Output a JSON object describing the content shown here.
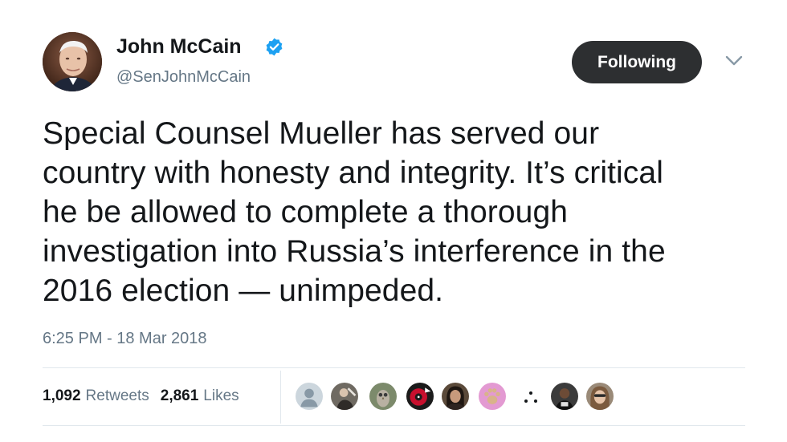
{
  "user": {
    "name": "John McCain",
    "handle": "@SenJohnMcCain",
    "verified": true,
    "avatar_icon": "profile-photo"
  },
  "follow_button": {
    "label": "Following"
  },
  "menu": {
    "icon": "chevron-down-icon"
  },
  "tweet": {
    "lines": [
      "Special Counsel Mueller has served our",
      "country with honesty and integrity. It’s critical",
      "he be allowed to complete a thorough",
      "investigation into Russia’s interference in the",
      "2016 election — unimpeded."
    ],
    "timestamp": "6:25 PM - 18 Mar 2018"
  },
  "stats": {
    "retweets": {
      "count": "1,092",
      "label": "Retweets"
    },
    "likes": {
      "count": "2,861",
      "label": "Likes"
    }
  },
  "colors": {
    "text": "#14171a",
    "secondary": "#657786",
    "verified_blue": "#1da1f2",
    "button_bg": "#2d2f31",
    "divider": "#e1e8ed"
  }
}
